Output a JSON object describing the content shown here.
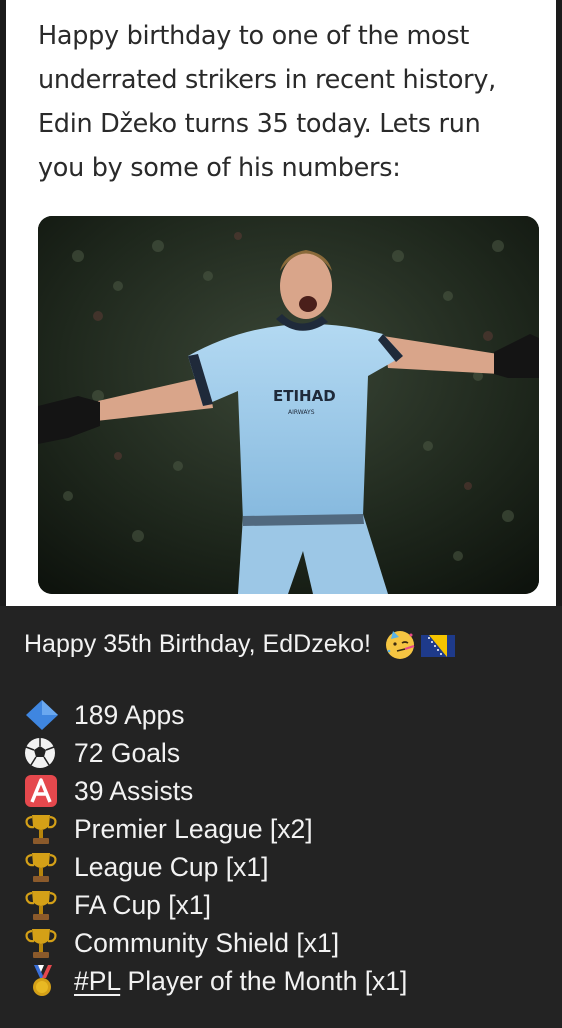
{
  "tweet": {
    "text_lines": [
      "Happy birthday to one of the most",
      "underrated strikers in recent history,",
      "Edin Džeko turns 35 today. Lets run",
      "you by some of his numbers:"
    ],
    "photo": {
      "kit_sponsor": "ETIHAD",
      "kit_sponsor_sub": "AIRWAYS"
    }
  },
  "message": {
    "title": "Happy 35th Birthday, EdDzeko!",
    "title_emojis": [
      "partying-face-icon",
      "bosnia-flag-icon"
    ],
    "stats": [
      {
        "icon": "blue-diamond-icon",
        "text": "189 Apps"
      },
      {
        "icon": "soccer-ball-icon",
        "text": "72 Goals"
      },
      {
        "icon": "a-button-icon",
        "text": "39 Assists"
      },
      {
        "icon": "trophy-icon",
        "text": "Premier League [x2]"
      },
      {
        "icon": "trophy-icon",
        "text": "League Cup [x1]"
      },
      {
        "icon": "trophy-icon",
        "text": "FA Cup [x1]"
      },
      {
        "icon": "trophy-icon",
        "text": "Community Shield [x1]"
      },
      {
        "icon": "medal-icon",
        "hashtag": "#PL",
        "text": " Player of the Month [x1]"
      }
    ]
  },
  "colors": {
    "message_bg": "#232323",
    "tweet_bg": "#ffffff",
    "kit_sky_blue": "#9fcbeb",
    "trophy_gold": "#d4a017"
  }
}
